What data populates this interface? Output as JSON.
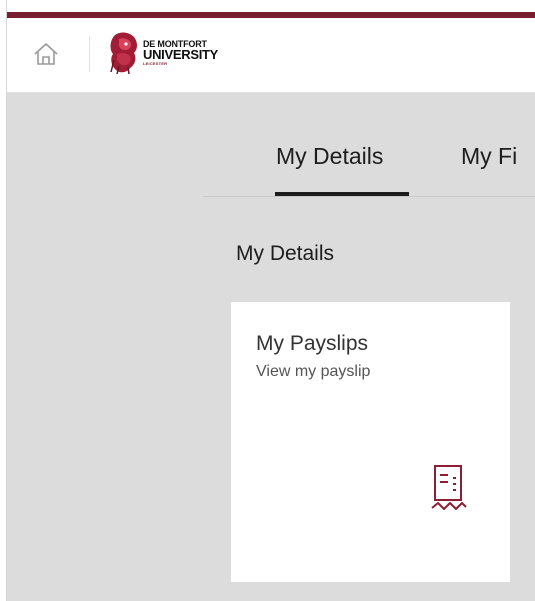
{
  "header": {
    "home_icon": "home-icon",
    "logo": {
      "line1": "DE MONTFORT",
      "line2": "UNIVERSITY",
      "line3": "LEICESTER",
      "emblem_icon": "lion-crest-icon"
    }
  },
  "tabs": [
    {
      "label": "My Details",
      "selected": true
    },
    {
      "label": "My Fi",
      "selected": false
    }
  ],
  "section": {
    "title": "My Details"
  },
  "tiles": [
    {
      "title": "My Payslips",
      "subtitle": "View my payslip",
      "icon": "payslip-icon"
    }
  ],
  "colors": {
    "brand": "#7a1d2e",
    "background": "#dcdcdc",
    "tab_indicator": "#1d1d1d",
    "tile_background": "#ffffff"
  }
}
